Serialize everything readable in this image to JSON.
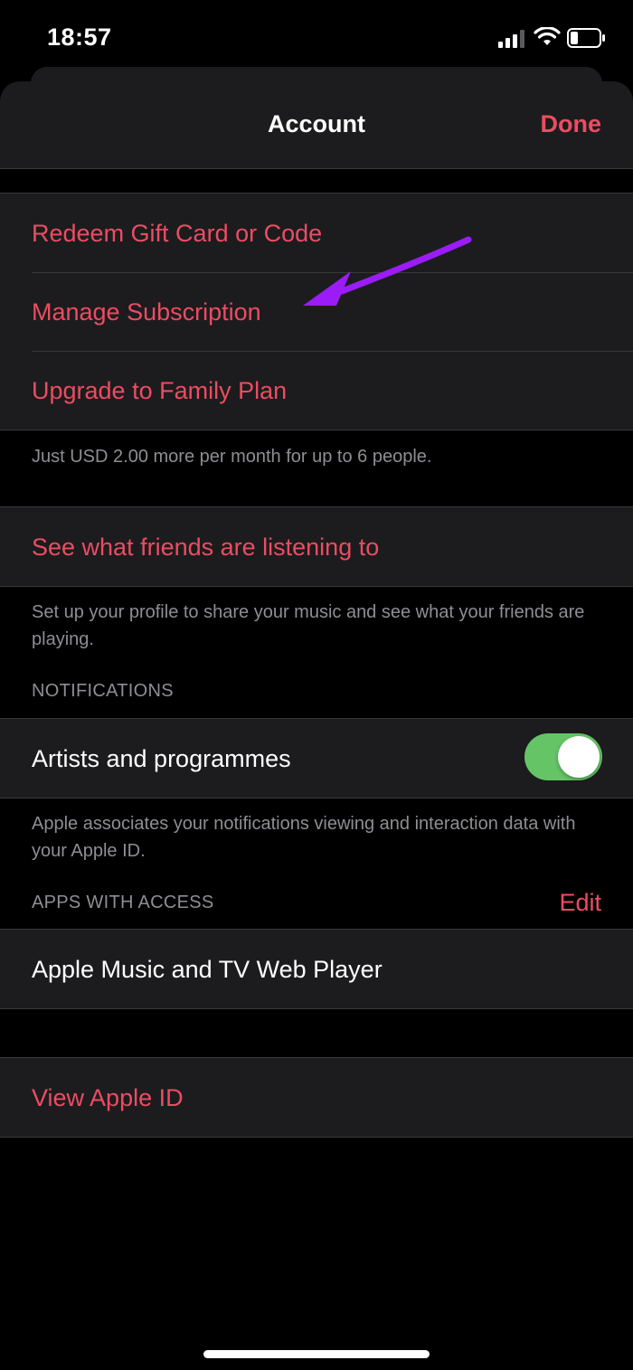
{
  "status_bar": {
    "time": "18:57",
    "icons": [
      "cellular-signal-icon",
      "wifi-icon",
      "battery-icon"
    ]
  },
  "nav": {
    "title": "Account",
    "done_label": "Done"
  },
  "account_actions": [
    {
      "label": "Redeem Gift Card or Code"
    },
    {
      "label": "Manage Subscription"
    },
    {
      "label": "Upgrade to Family Plan"
    }
  ],
  "family_plan_note": "Just USD 2.00 more per month for up to 6 people.",
  "friends": {
    "label": "See what friends are listening to",
    "note": "Set up your profile to share your music and see what your friends are playing."
  },
  "notifications": {
    "header": "NOTIFICATIONS",
    "toggle_label": "Artists and programmes",
    "toggle_on": true,
    "note": "Apple associates your notifications viewing and interaction data with your Apple ID."
  },
  "apps_with_access": {
    "header": "APPS WITH ACCESS",
    "edit_label": "Edit",
    "apps": [
      "Apple Music and TV Web Player"
    ]
  },
  "view_apple_id_label": "View Apple ID",
  "colors": {
    "accent": "#ec4c62",
    "toggle_on": "#65c466",
    "annotation_arrow": "#9b1cf6",
    "cell_background": "#1c1c1e",
    "page_background": "#000000",
    "secondary_text": "#8e8e93"
  }
}
